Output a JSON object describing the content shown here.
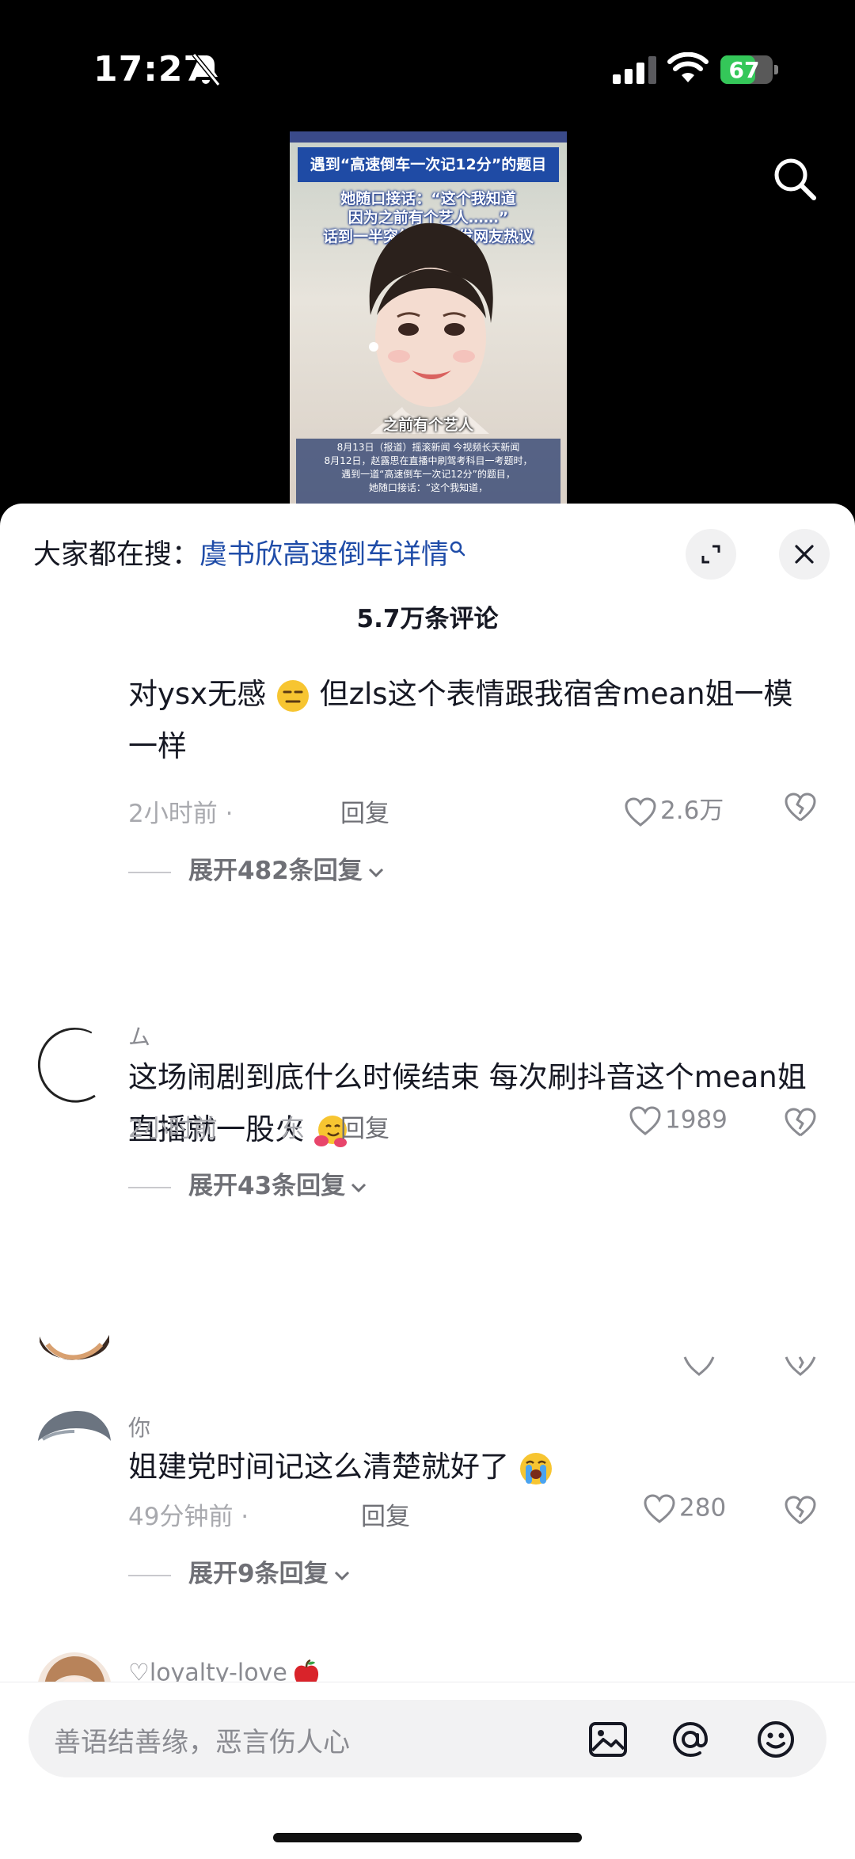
{
  "status": {
    "time": "17:27",
    "battery": "67",
    "battery_level": 0.67
  },
  "video": {
    "header": "遇到“高速倒车一次记12分”的题目",
    "lines": [
      "她随口接话：“这个我知道",
      "因为之前有个艺人……”",
      "话到一半突然刹车引发网友热议"
    ],
    "caption": "之前有个艺人",
    "news": [
      "8月13日（报道）摇滚新闻 今视频长天新闻",
      "8月12日，赵露思在直播中刷驾考科目一考题时，",
      "遇到一道“高速倒车一次记12分”的题目，",
      "她随口接话：“这个我知道，"
    ]
  },
  "sheet": {
    "trend_label": "大家都在搜：",
    "trend_term": "虞书欣高速倒车详情",
    "comment_count": "5.7万条评论"
  },
  "comments": [
    {
      "username": "",
      "text_a": "对ysx无感",
      "text_b": "但zls这个表情跟我宿舍mean姐一模一样",
      "time": "2小时前 ·",
      "reply": "回复",
      "likes": "2.6万",
      "expand": "展开482条回复"
    },
    {
      "username": "ム",
      "text": "这场闹剧到底什么时候结束 每次刷抖音这个mean姐直播就一股火",
      "time": "2小时前",
      "location": "东",
      "reply": "回复",
      "likes": "1989",
      "expand": "展开43条回复"
    },
    {
      "username": "你",
      "text": "姐建党时间记这么清楚就好了",
      "time": "49分钟前 ·",
      "reply": "回复",
      "likes": "280",
      "expand": "展开9条回复"
    },
    {
      "username": "♡loyalty-love"
    }
  ],
  "input": {
    "placeholder": "善语结善缘，恶言伤人心"
  }
}
